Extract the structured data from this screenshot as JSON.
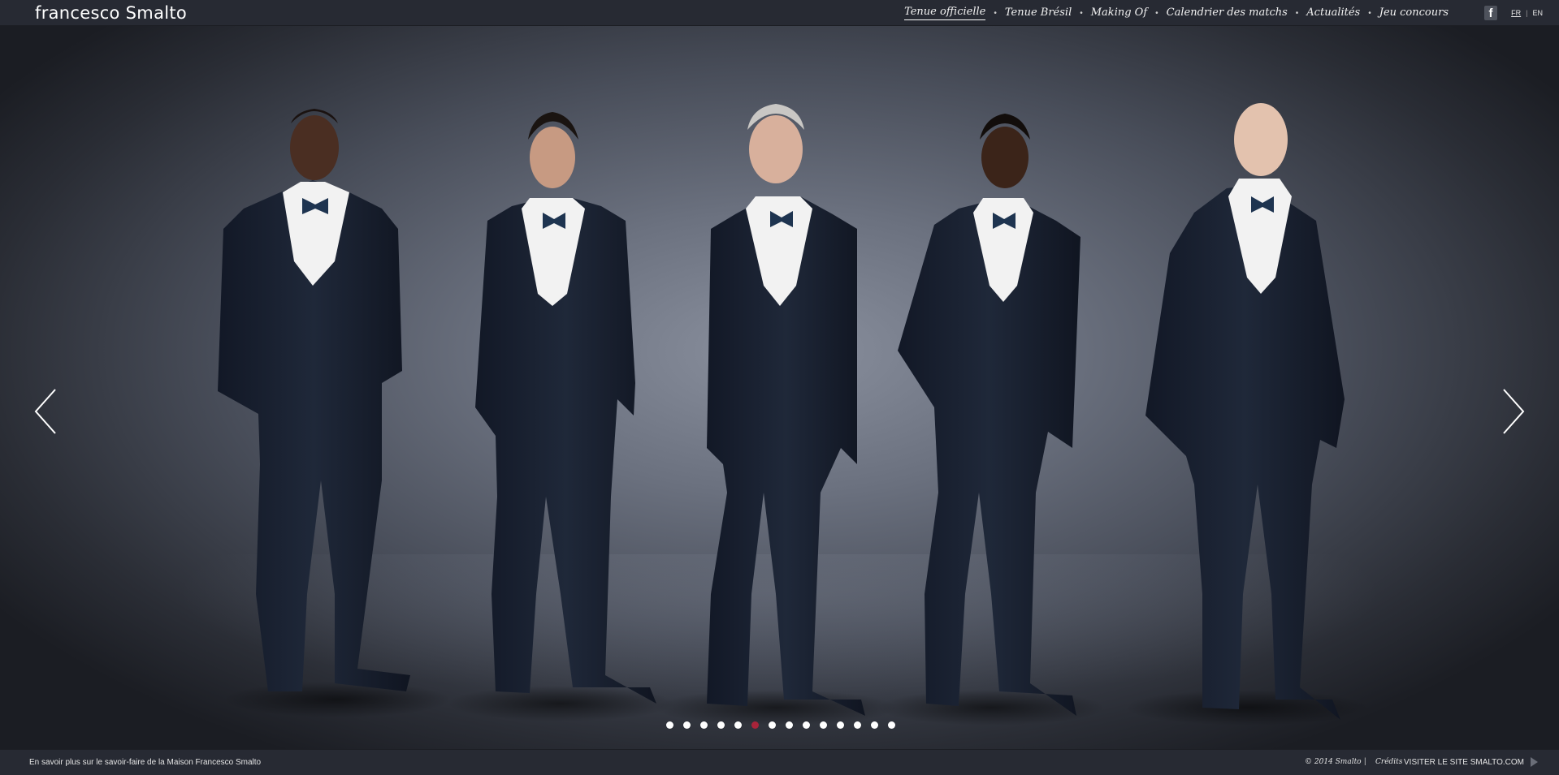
{
  "header": {
    "logo": "francesco Smalto",
    "nav": [
      {
        "label": "Tenue officielle",
        "active": true
      },
      {
        "label": "Tenue Brésil",
        "active": false
      },
      {
        "label": "Making Of",
        "active": false
      },
      {
        "label": "Calendrier des matchs",
        "active": false
      },
      {
        "label": "Actualités",
        "active": false
      },
      {
        "label": "Jeu concours",
        "active": false
      }
    ],
    "facebook_icon": "facebook-icon",
    "facebook_glyph": "f",
    "lang": {
      "fr": "FR",
      "separator": "|",
      "en": "EN",
      "active": "FR"
    }
  },
  "slider": {
    "slide_count": 14,
    "active_slide": 6,
    "prev_icon": "chevron-left-icon",
    "next_icon": "chevron-right-icon",
    "subjects": 5,
    "colors": {
      "suit": "#1a2232",
      "bowtie": "#1e3450",
      "shirt": "#f2f2f2",
      "background": "#6b717f"
    }
  },
  "footer": {
    "learn_more": "En savoir plus sur le savoir-faire de la Maison Francesco Smalto",
    "copyright": "© 2014 Smalto",
    "separator": "|",
    "credits": "Crédits",
    "visit": "VISITER LE SITE SMALTO.COM"
  },
  "colors": {
    "bar": "#272a33",
    "active_dot": "#a8243a",
    "text": "#ffffff"
  }
}
